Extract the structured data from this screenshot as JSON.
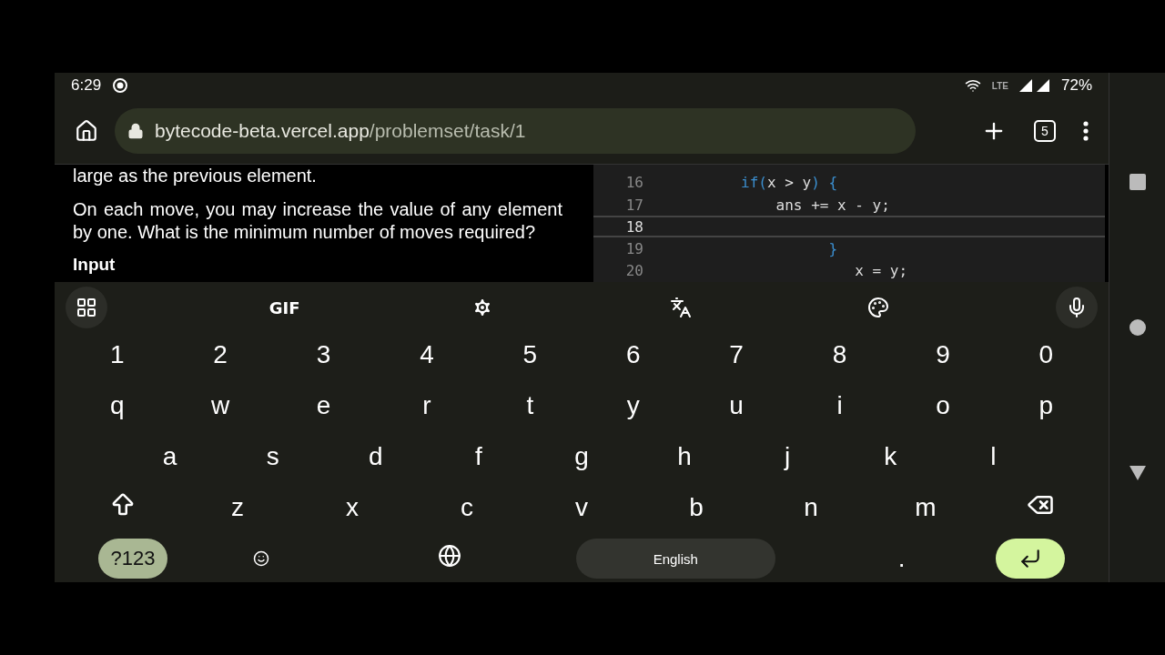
{
  "status_bar": {
    "time": "6:29",
    "battery": "72%",
    "network": "LTE"
  },
  "browser": {
    "url_host": "bytecode-beta.vercel.app",
    "url_path": "/problemset/task/1",
    "tab_count": "5"
  },
  "problem": {
    "paragraphs": [
      "large as the previous element.",
      "On each move, you may increase the value of any element by one. What is the minimum number of moves required?"
    ],
    "heading": "Input"
  },
  "editor": {
    "lines": [
      {
        "number": "16",
        "current": false,
        "tokens": [
          {
            "text": "        if(",
            "kind": "keyword"
          },
          {
            "text": "x > y",
            "kind": "plain"
          },
          {
            "text": ") {",
            "kind": "keyword"
          }
        ]
      },
      {
        "number": "17",
        "current": false,
        "tokens": [
          {
            "text": "            ans += x - y;",
            "kind": "plain"
          }
        ]
      },
      {
        "number": "18",
        "current": true
      },
      {
        "number": "19",
        "current": false,
        "tokens": [
          {
            "text": "                  }",
            "kind": "keyword"
          }
        ]
      },
      {
        "number": "20",
        "current": false,
        "tokens": [
          {
            "text": "                     x = y;",
            "kind": "plain"
          }
        ]
      }
    ]
  },
  "keyboard": {
    "toolbar": [
      {
        "kind": "apps"
      },
      {
        "kind": "gif",
        "label": "GIF"
      },
      {
        "kind": "settings"
      },
      {
        "kind": "translate"
      },
      {
        "kind": "palette"
      },
      {
        "kind": "mic"
      }
    ],
    "rows": [
      [
        "1",
        "2",
        "3",
        "4",
        "5",
        "6",
        "7",
        "8",
        "9",
        "0"
      ],
      [
        "q",
        "w",
        "e",
        "r",
        "t",
        "y",
        "u",
        "i",
        "o",
        "p"
      ],
      [
        "a",
        "s",
        "d",
        "f",
        "g",
        "h",
        "j",
        "k",
        "l"
      ],
      [
        "z",
        "x",
        "c",
        "v",
        "b",
        "n",
        "m"
      ]
    ],
    "symbols_key": "?123",
    "space_label": "English",
    "period_key": "."
  }
}
